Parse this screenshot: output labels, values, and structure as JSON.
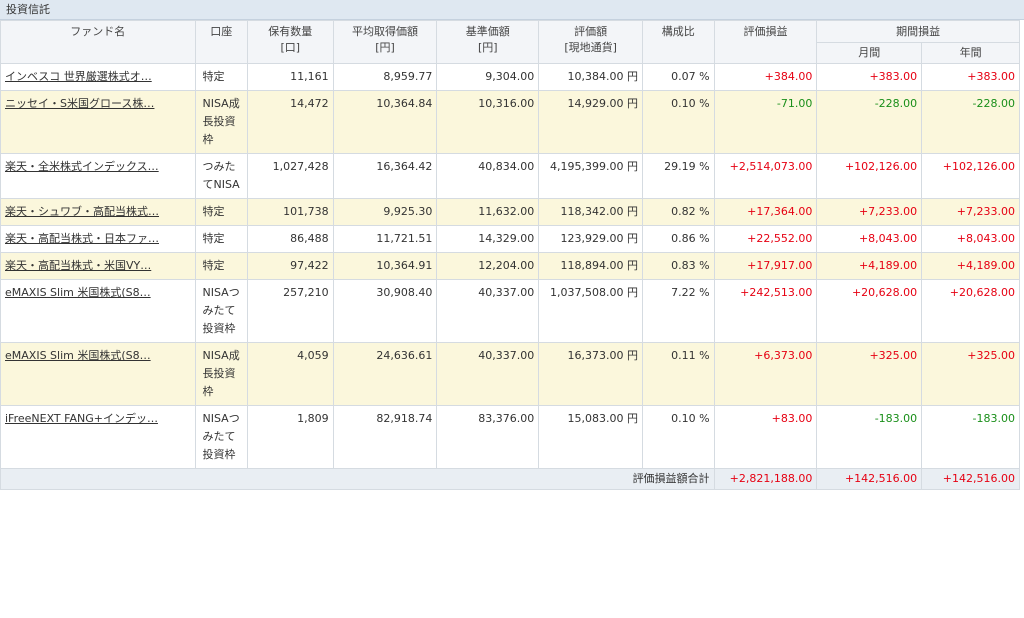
{
  "section_title": "投資信託",
  "headers": {
    "fund_name": "ファンド名",
    "account": "口座",
    "quantity": "保有数量",
    "quantity_unit": "[口]",
    "avg_cost": "平均取得価額",
    "avg_cost_unit": "[円]",
    "base_price": "基準価額",
    "base_price_unit": "[円]",
    "valuation": "評価額",
    "valuation_unit": "[現地通貨]",
    "ratio": "構成比",
    "unrealized": "評価損益",
    "period": "期間損益",
    "monthly": "月間",
    "yearly": "年間"
  },
  "rows": [
    {
      "fund": "インベスコ 世界厳選株式オ…",
      "account": "特定",
      "quantity": "11,161",
      "avg_cost": "8,959.77",
      "base_price": "9,304.00",
      "valuation": "10,384.00 円",
      "ratio": "0.07 %",
      "unrealized": "+384.00",
      "monthly": "+383.00",
      "yearly": "+383.00",
      "u_sign": "pos",
      "m_sign": "pos",
      "y_sign": "pos"
    },
    {
      "fund": "ニッセイ・S米国グロース株…",
      "account": "NISA成長投資枠",
      "quantity": "14,472",
      "avg_cost": "10,364.84",
      "base_price": "10,316.00",
      "valuation": "14,929.00 円",
      "ratio": "0.10 %",
      "unrealized": "-71.00",
      "monthly": "-228.00",
      "yearly": "-228.00",
      "u_sign": "neg",
      "m_sign": "neg",
      "y_sign": "neg"
    },
    {
      "fund": "楽天・全米株式インデックス…",
      "account": "つみたてNISA",
      "quantity": "1,027,428",
      "avg_cost": "16,364.42",
      "base_price": "40,834.00",
      "valuation": "4,195,399.00 円",
      "ratio": "29.19 %",
      "unrealized": "+2,514,073.00",
      "monthly": "+102,126.00",
      "yearly": "+102,126.00",
      "u_sign": "pos",
      "m_sign": "pos",
      "y_sign": "pos"
    },
    {
      "fund": "楽天・シュワブ・高配当株式…",
      "account": "特定",
      "quantity": "101,738",
      "avg_cost": "9,925.30",
      "base_price": "11,632.00",
      "valuation": "118,342.00 円",
      "ratio": "0.82 %",
      "unrealized": "+17,364.00",
      "monthly": "+7,233.00",
      "yearly": "+7,233.00",
      "u_sign": "pos",
      "m_sign": "pos",
      "y_sign": "pos"
    },
    {
      "fund": "楽天・高配当株式・日本ファ…",
      "account": "特定",
      "quantity": "86,488",
      "avg_cost": "11,721.51",
      "base_price": "14,329.00",
      "valuation": "123,929.00 円",
      "ratio": "0.86 %",
      "unrealized": "+22,552.00",
      "monthly": "+8,043.00",
      "yearly": "+8,043.00",
      "u_sign": "pos",
      "m_sign": "pos",
      "y_sign": "pos"
    },
    {
      "fund": "楽天・高配当株式・米国VY…",
      "account": "特定",
      "quantity": "97,422",
      "avg_cost": "10,364.91",
      "base_price": "12,204.00",
      "valuation": "118,894.00 円",
      "ratio": "0.83 %",
      "unrealized": "+17,917.00",
      "monthly": "+4,189.00",
      "yearly": "+4,189.00",
      "u_sign": "pos",
      "m_sign": "pos",
      "y_sign": "pos"
    },
    {
      "fund": "eMAXIS Slim 米国株式(S8…",
      "account": "NISAつみたて投資枠",
      "quantity": "257,210",
      "avg_cost": "30,908.40",
      "base_price": "40,337.00",
      "valuation": "1,037,508.00 円",
      "ratio": "7.22 %",
      "unrealized": "+242,513.00",
      "monthly": "+20,628.00",
      "yearly": "+20,628.00",
      "u_sign": "pos",
      "m_sign": "pos",
      "y_sign": "pos"
    },
    {
      "fund": "eMAXIS Slim 米国株式(S8…",
      "account": "NISA成長投資枠",
      "quantity": "4,059",
      "avg_cost": "24,636.61",
      "base_price": "40,337.00",
      "valuation": "16,373.00 円",
      "ratio": "0.11 %",
      "unrealized": "+6,373.00",
      "monthly": "+325.00",
      "yearly": "+325.00",
      "u_sign": "pos",
      "m_sign": "pos",
      "y_sign": "pos"
    },
    {
      "fund": "iFreeNEXT FANG+インデッ…",
      "account": "NISAつみたて投資枠",
      "quantity": "1,809",
      "avg_cost": "82,918.74",
      "base_price": "83,376.00",
      "valuation": "15,083.00 円",
      "ratio": "0.10 %",
      "unrealized": "+83.00",
      "monthly": "-183.00",
      "yearly": "-183.00",
      "u_sign": "pos",
      "m_sign": "neg",
      "y_sign": "neg"
    }
  ],
  "footer": {
    "label": "評価損益額合計",
    "unrealized": "+2,821,188.00",
    "monthly": "+142,516.00",
    "yearly": "+142,516.00"
  }
}
